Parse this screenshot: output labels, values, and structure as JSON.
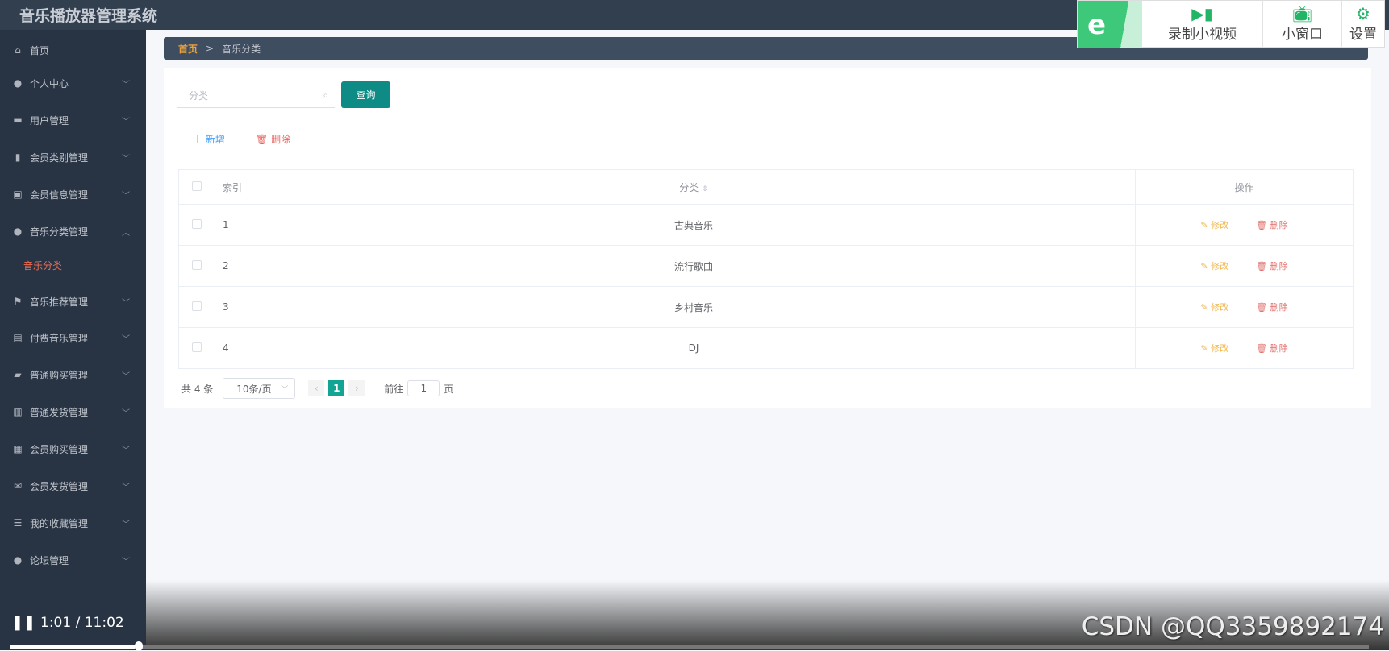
{
  "header": {
    "title": "音乐播放器管理系统"
  },
  "sidebar": {
    "items": [
      {
        "label": "首页",
        "icon": "home-icon",
        "chev": ""
      },
      {
        "label": "个人中心",
        "icon": "user-icon",
        "chev": "v"
      },
      {
        "label": "用户管理",
        "icon": "briefcase-icon",
        "chev": "v"
      },
      {
        "label": "会员类别管理",
        "icon": "bar-chart-icon",
        "chev": "v"
      },
      {
        "label": "会员信息管理",
        "icon": "clipboard-x-icon",
        "chev": "v"
      },
      {
        "label": "音乐分类管理",
        "icon": "user-icon",
        "chev": "^"
      },
      {
        "label": "音乐推荐管理",
        "icon": "flag-icon",
        "chev": "v"
      },
      {
        "label": "付费音乐管理",
        "icon": "clipboard-icon",
        "chev": "v"
      },
      {
        "label": "普通购买管理",
        "icon": "wallet-icon",
        "chev": "v"
      },
      {
        "label": "普通发货管理",
        "icon": "box-icon",
        "chev": "v"
      },
      {
        "label": "会员购买管理",
        "icon": "grid-icon",
        "chev": "v"
      },
      {
        "label": "会员发货管理",
        "icon": "mail-icon",
        "chev": "v"
      },
      {
        "label": "我的收藏管理",
        "icon": "sliders-icon",
        "chev": "v"
      },
      {
        "label": "论坛管理",
        "icon": "chat-icon",
        "chev": "v"
      }
    ],
    "sub_active": "音乐分类"
  },
  "breadcrumb": {
    "home": "首页",
    "sep": ">",
    "current": "音乐分类"
  },
  "search": {
    "placeholder": "分类",
    "button": "查询"
  },
  "actions": {
    "add": "新增",
    "delete": "删除"
  },
  "table": {
    "headers": [
      "索引",
      "分类",
      "操作"
    ],
    "rows": [
      {
        "index": "1",
        "name": "古典音乐"
      },
      {
        "index": "2",
        "name": "流行歌曲"
      },
      {
        "index": "3",
        "name": "乡村音乐"
      },
      {
        "index": "4",
        "name": "DJ"
      }
    ],
    "edit": "修改",
    "delete": "删除"
  },
  "pagination": {
    "total": "共 4 条",
    "page_size": "10条/页",
    "current": "1",
    "goto": "前往",
    "goto_value": "1",
    "page_unit": "页"
  },
  "toolbar": {
    "record": "录制小视频",
    "mini": "小窗口",
    "settings": "设置"
  },
  "video": {
    "time": "1:01 / 11:02",
    "progress": 0.092,
    "watermark": "CSDN @QQ3359892174"
  },
  "colors": {
    "accent": "#0d8b84",
    "active_menu": "#f56c50",
    "edit": "#f0b64b",
    "delete": "#e0706b"
  }
}
